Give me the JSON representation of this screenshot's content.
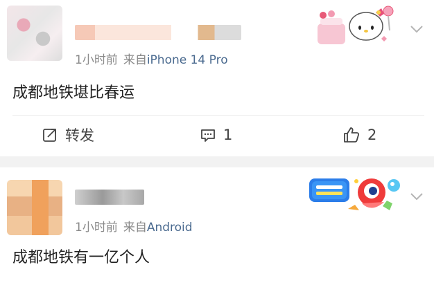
{
  "posts": [
    {
      "time": "1小时前",
      "source_prefix": "来自",
      "source_name": "iPhone 14 Pro",
      "content": "成都地铁堪比春运",
      "actions": {
        "repost_label": "转发",
        "comment_count": "1",
        "like_count": "2"
      }
    },
    {
      "time": "1小时前",
      "source_prefix": "来自",
      "source_name": "Android",
      "content": "成都地铁有一亿个人"
    }
  ],
  "colors": {
    "source_link": "#4a6a8f",
    "meta_gray": "#8a8a8a",
    "separator": "#f2f2f2"
  },
  "icons": [
    "chevron-down-icon",
    "repost-icon",
    "comment-icon",
    "like-icon"
  ]
}
